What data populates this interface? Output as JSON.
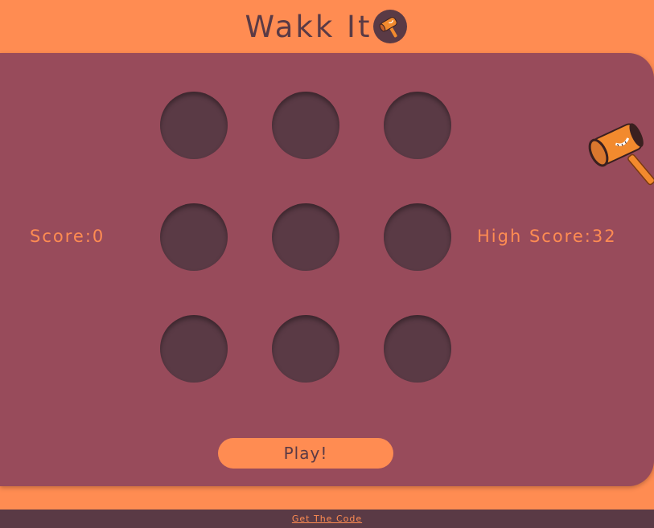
{
  "header": {
    "title": "Wakk It",
    "logo_icon": "hammer-icon"
  },
  "game": {
    "score_label": "Score:0",
    "high_score_label": "High Score:32",
    "score": 0,
    "high_score": 32,
    "holes": [
      1,
      2,
      3,
      4,
      5,
      6,
      7,
      8,
      9
    ],
    "play_label": "Play!",
    "cursor_icon": "hammer-cursor-icon"
  },
  "footer": {
    "link_label": "Get The Code"
  },
  "colors": {
    "background": "#FF8C52",
    "board": "#984B5B",
    "hole": "#5A3A45",
    "text_dark": "#5A3A45",
    "accent": "#FF8C52"
  }
}
